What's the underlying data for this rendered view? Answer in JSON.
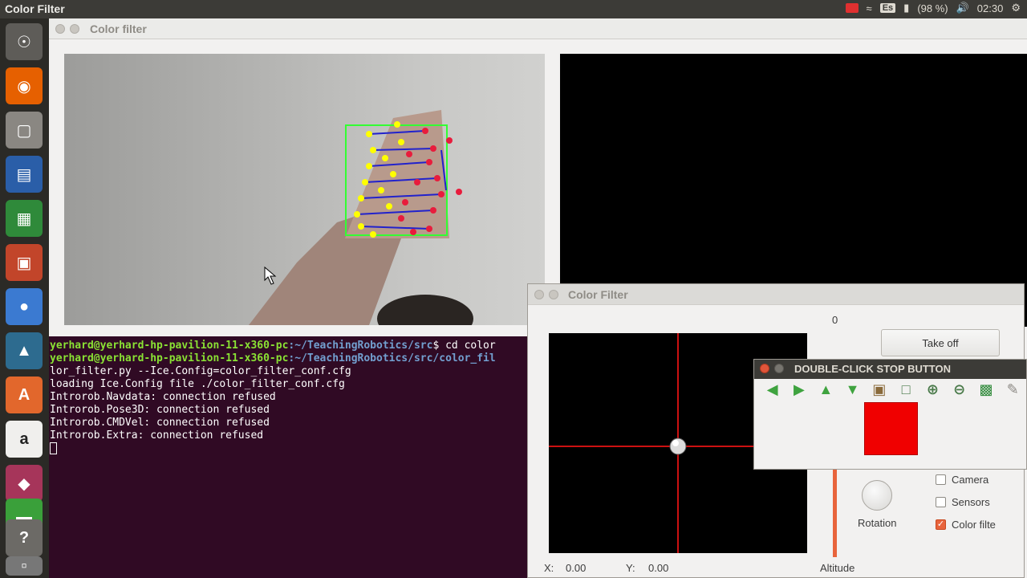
{
  "topbar": {
    "title": "Color Filter",
    "keyboard": "Es",
    "battery": "(98 %)",
    "time": "02:30"
  },
  "launcher": {
    "items": [
      "ubuntu-dash",
      "firefox",
      "files",
      "writer",
      "calc",
      "impress",
      "chrome",
      "matlab",
      "software-center",
      "amazon",
      "app",
      "app",
      "help",
      "trash"
    ]
  },
  "main_window": {
    "title": "Color filter"
  },
  "terminal": {
    "line1_user": "yerhard@yerhard-hp-pavilion-11-x360-pc",
    "line1_path": ":~/TeachingRobotics/src",
    "line1_cmd": "$ cd color",
    "line2_user": "yerhard@yerhard-hp-pavilion-11-x360-pc",
    "line2_path": ":~/TeachingRobotics/src/color_fil",
    "lines": [
      "lor_filter.py --Ice.Config=color_filter_conf.cfg",
      "loading Ice.Config file ./color_filter_conf.cfg",
      "Introrob.Navdata: connection refused",
      "Introrob.Pose3D: connection refused",
      "Introrob.CMDVel: connection refused",
      "Introrob.Extra: connection refused"
    ]
  },
  "color_filter_window": {
    "title": "Color Filter",
    "slider_value": "0",
    "takeoff_label": "Take off",
    "x_label": "X:",
    "x_value": "0.00",
    "y_label": "Y:",
    "y_value": "0.00",
    "altitude_label": "Altitude",
    "rotation_label": "Rotation",
    "checkboxes": [
      {
        "label": "Camera",
        "checked": false
      },
      {
        "label": "Sensors",
        "checked": false
      },
      {
        "label": "Color filte",
        "checked": true
      }
    ]
  },
  "stop_window": {
    "title": "DOUBLE-CLICK STOP BUTTON",
    "tools": [
      "back-arrow",
      "forward-arrow",
      "up-arrow",
      "down-arrow",
      "image",
      "zoom-fit",
      "zoom-in",
      "zoom-out",
      "save",
      "edit"
    ],
    "stop_color": "#f00000"
  }
}
